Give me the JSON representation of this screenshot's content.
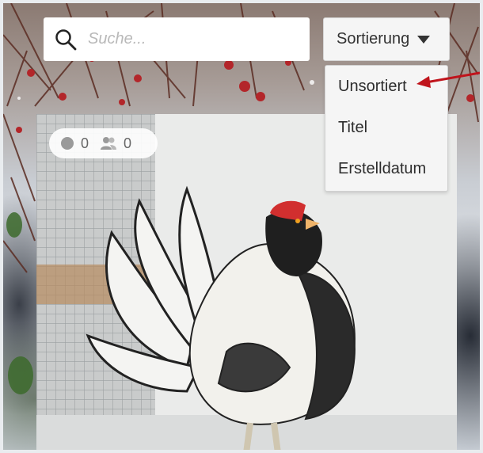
{
  "search": {
    "placeholder": "Suche..."
  },
  "sort": {
    "label": "Sortierung",
    "options": [
      "Unsortiert",
      "Titel",
      "Erstelldatum"
    ]
  },
  "card": {
    "stats": {
      "comments": "0",
      "followers": "0"
    }
  },
  "colors": {
    "annotation": "#c0141c",
    "text": "#333333",
    "icon": "#999999"
  }
}
